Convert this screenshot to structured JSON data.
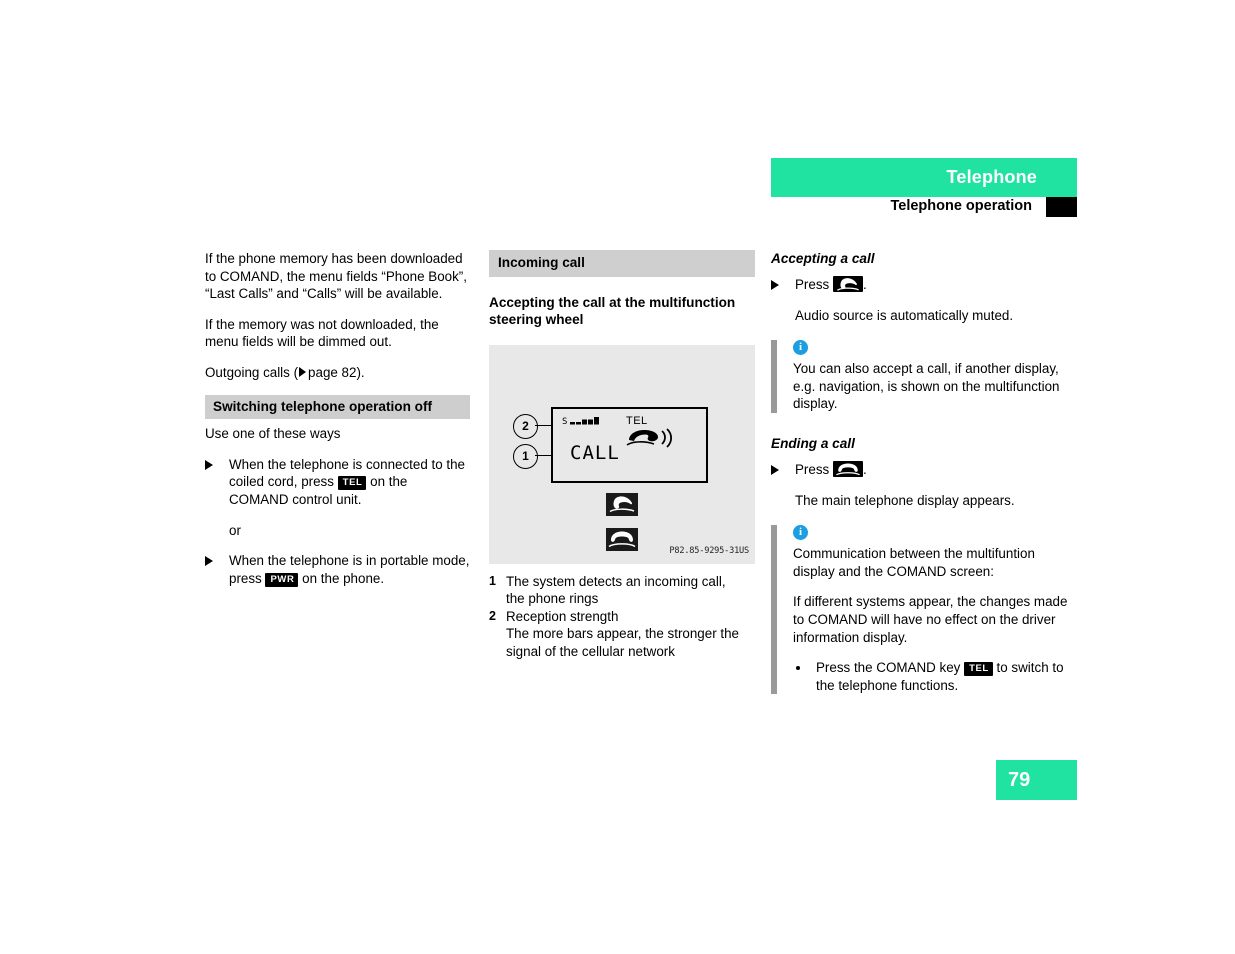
{
  "header": {
    "title": "Telephone",
    "subtitle": "Telephone operation",
    "accent_color": "#20E3A2",
    "tab_color": "#000000"
  },
  "page_number": "79",
  "left_column": {
    "paragraphs": [
      "If the phone memory has been downloaded to COMAND, the menu fields “Phone Book”, “Last Calls” and “Calls” will be available.",
      "If the memory was not downloaded, the menu fields will be dimmed out."
    ],
    "page_ref": {
      "prefix": "Outgoing calls (",
      "label": "page 82",
      "suffix": ")."
    },
    "section_heading": "Switching telephone operation off",
    "intro": "Use one of these ways",
    "steps": [
      {
        "before": "When the telephone is connected to the coiled cord, press ",
        "key": "TEL",
        "after": " on the COMAND control unit."
      },
      {
        "before": "When the telephone is in portable mode, press ",
        "key": "PWR",
        "after": " on the phone."
      }
    ],
    "or_text": "or"
  },
  "middle_column": {
    "section_heading": "Incoming call",
    "subheading": "Accepting the call at the multifunction steering wheel",
    "figure": {
      "display": {
        "signal_label": "S",
        "signal_bars": 5,
        "signal_filled": 3,
        "mode_label": "TEL",
        "status_text": "CALL",
        "ring_icon": "ringing-handset-icon"
      },
      "callouts": [
        {
          "number": "2"
        },
        {
          "number": "1"
        }
      ],
      "buttons": [
        {
          "icon": "accept-call-icon"
        },
        {
          "icon": "end-call-icon"
        }
      ],
      "code": "P82.85-9295-31US"
    },
    "legend": [
      {
        "num": "1",
        "lines": [
          "The system detects an incoming call,",
          "the phone rings"
        ]
      },
      {
        "num": "2",
        "lines": [
          "Reception strength",
          "The more bars appear, the stronger the",
          "signal of the cellular network"
        ]
      }
    ]
  },
  "right_column": {
    "accepting": {
      "heading": "Accepting a call",
      "press_label": "Press",
      "press_icon": "accept-call-icon",
      "press_suffix": ".",
      "result": "Audio source is automatically muted.",
      "note": {
        "icon": "info-icon",
        "text": "You can also accept a call, if another display, e.g. navigation, is shown on the multifunction display."
      }
    },
    "ending": {
      "heading": "Ending a call",
      "press_label": "Press",
      "press_icon": "end-call-icon",
      "press_suffix": ".",
      "result": "The main telephone display appears.",
      "note": {
        "icon": "info-icon",
        "paragraphs": [
          "Communication between the multifuntion display and the COMAND screen:",
          "If different systems appear, the changes made to COMAND will have no effect on the driver information display."
        ],
        "bullet": {
          "before": "Press the COMAND key ",
          "key": "TEL",
          "after": " to switch to the telephone functions."
        }
      }
    }
  }
}
